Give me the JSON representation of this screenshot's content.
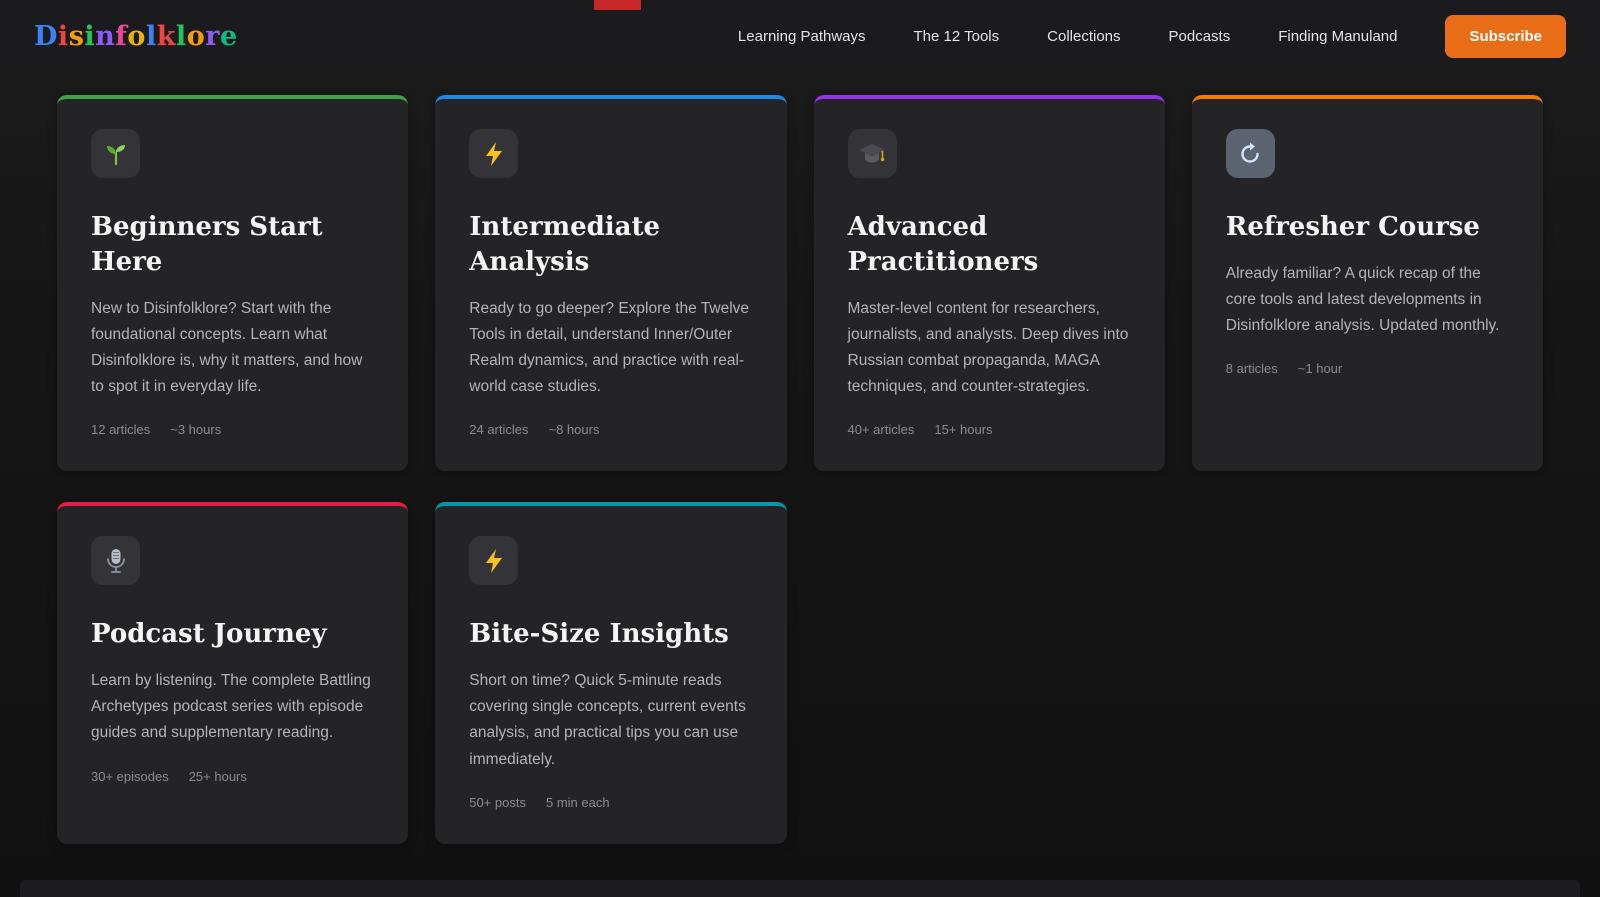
{
  "header": {
    "logo_text": "Disinfolklore",
    "logo_letters": [
      {
        "ch": "D",
        "color": "#3b82f6"
      },
      {
        "ch": "i",
        "color": "#ef4444"
      },
      {
        "ch": "s",
        "color": "#f59e0b"
      },
      {
        "ch": "i",
        "color": "#22c55e"
      },
      {
        "ch": "n",
        "color": "#8b5cf6"
      },
      {
        "ch": "f",
        "color": "#ec4899"
      },
      {
        "ch": "o",
        "color": "#eab308"
      },
      {
        "ch": "l",
        "color": "#3b82f6"
      },
      {
        "ch": "k",
        "color": "#ef4444"
      },
      {
        "ch": "l",
        "color": "#22c55e"
      },
      {
        "ch": "o",
        "color": "#f59e0b"
      },
      {
        "ch": "r",
        "color": "#8b5cf6"
      },
      {
        "ch": "e",
        "color": "#10b981"
      }
    ],
    "nav_items": [
      {
        "label": "Learning Pathways"
      },
      {
        "label": "The 12 Tools"
      },
      {
        "label": "Collections"
      },
      {
        "label": "Podcasts"
      },
      {
        "label": "Finding Manuland"
      }
    ],
    "subscribe_label": "Subscribe",
    "subscribe_color": "#e96d17"
  },
  "cards": [
    {
      "title": "Beginners Start Here",
      "description": "New to Disinfolklore? Start with the foundational concepts. Learn what Disinfolklore is, why it matters, and how to spot it in everyday life.",
      "meta1": "12 articles",
      "meta2": "~3 hours",
      "accent": "#43a047",
      "icon": "seedling-icon"
    },
    {
      "title": "Intermediate Analysis",
      "description": "Ready to go deeper? Explore the Twelve Tools in detail, understand Inner/Outer Realm dynamics, and practice with real-world case studies.",
      "meta1": "24 articles",
      "meta2": "~8 hours",
      "accent": "#1e88e5",
      "icon": "lightning-icon"
    },
    {
      "title": "Advanced Practitioners",
      "description": "Master-level content for researchers, journalists, and analysts. Deep dives into Russian combat propaganda, MAGA techniques, and counter-strategies.",
      "meta1": "40+ articles",
      "meta2": "15+ hours",
      "accent": "#9333ea",
      "icon": "graduation-cap-icon"
    },
    {
      "title": "Refresher Course",
      "description": "Already familiar? A quick recap of the core tools and latest developments in Disinfolklore analysis. Updated monthly.",
      "meta1": "8 articles",
      "meta2": "~1 hour",
      "accent": "#f57c00",
      "icon": "refresh-icon"
    },
    {
      "title": "Podcast Journey",
      "description": "Learn by listening. The complete Battling Archetypes podcast series with episode guides and supplementary reading.",
      "meta1": "30+ episodes",
      "meta2": "25+ hours",
      "accent": "#e11d48",
      "icon": "microphone-icon"
    },
    {
      "title": "Bite-Size Insights",
      "description": "Short on time? Quick 5-minute reads covering single concepts, current events analysis, and practical tips you can use immediately.",
      "meta1": "50+ posts",
      "meta2": "5 min each",
      "accent": "#0097a7",
      "icon": "lightning-icon"
    }
  ]
}
